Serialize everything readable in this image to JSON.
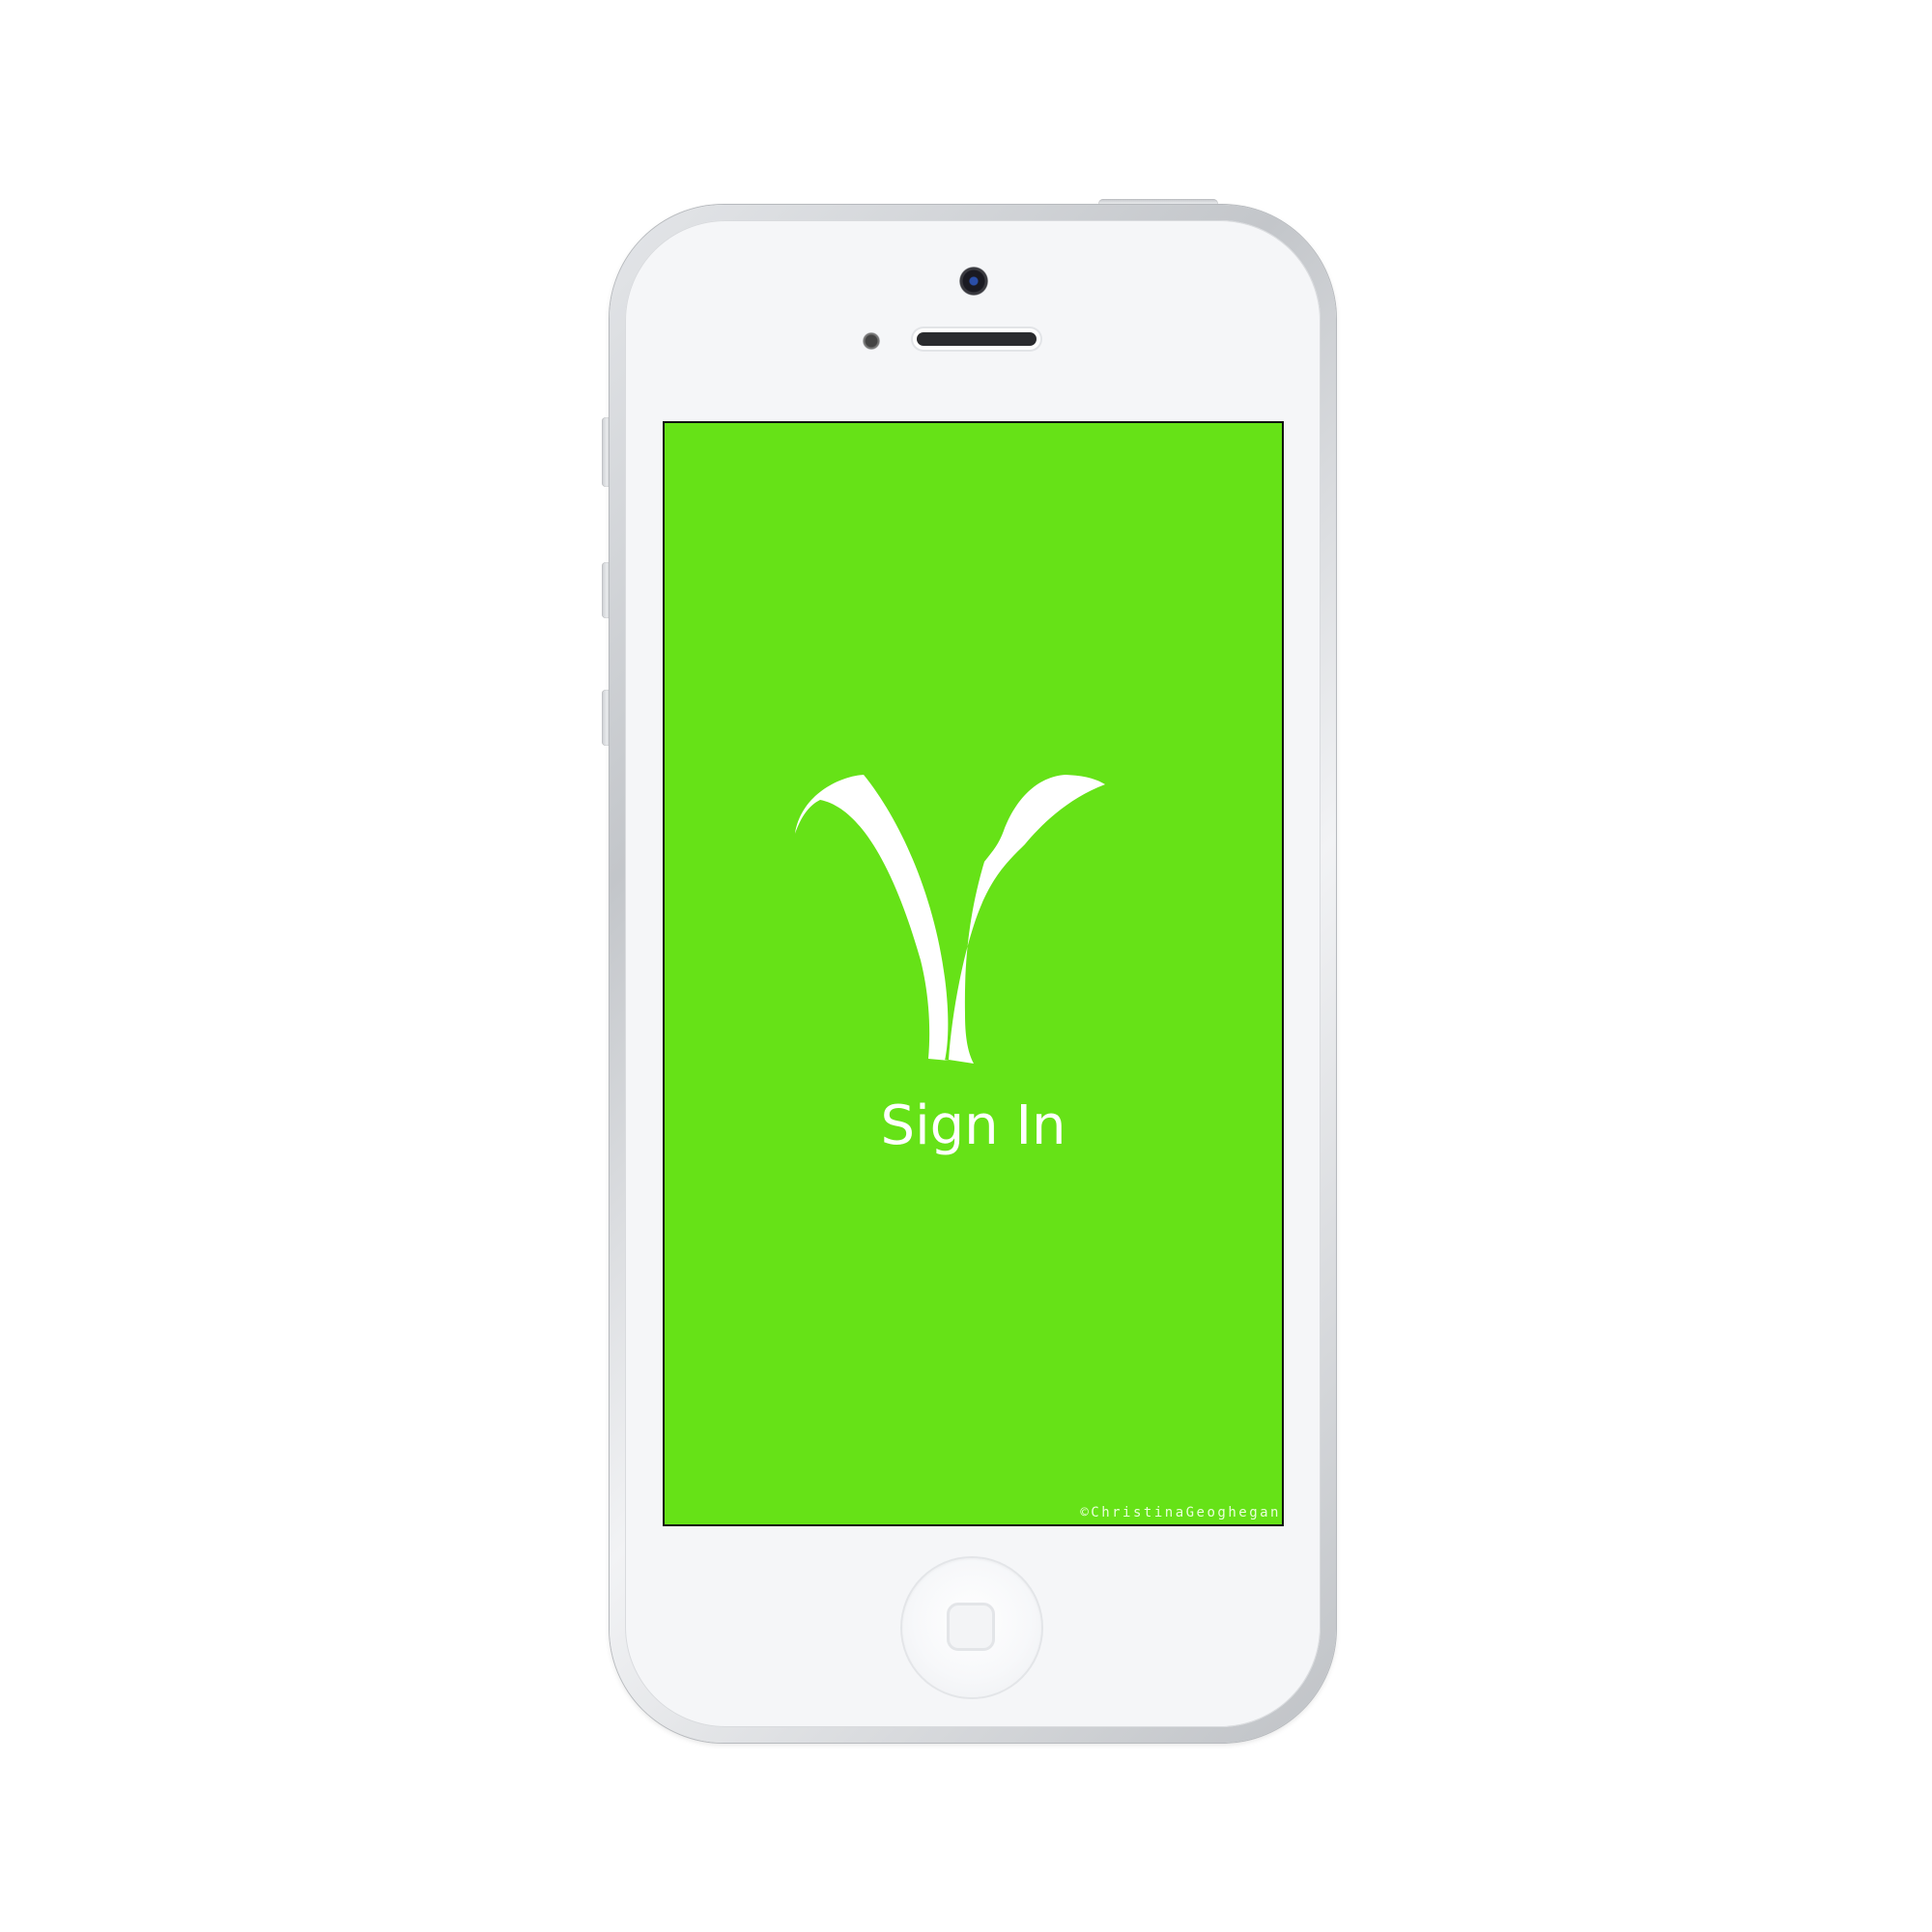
{
  "screen": {
    "background_color": "#66e217",
    "logo_icon": "sprout-v-logo-icon",
    "sign_in_label": "Sign In",
    "copyright": "©ChristinaGeoghegan"
  },
  "device": {
    "model": "white smartphone",
    "home_button_icon": "home-square-icon",
    "camera_icon": "front-camera-icon",
    "speaker_icon": "earpiece-speaker-icon"
  }
}
